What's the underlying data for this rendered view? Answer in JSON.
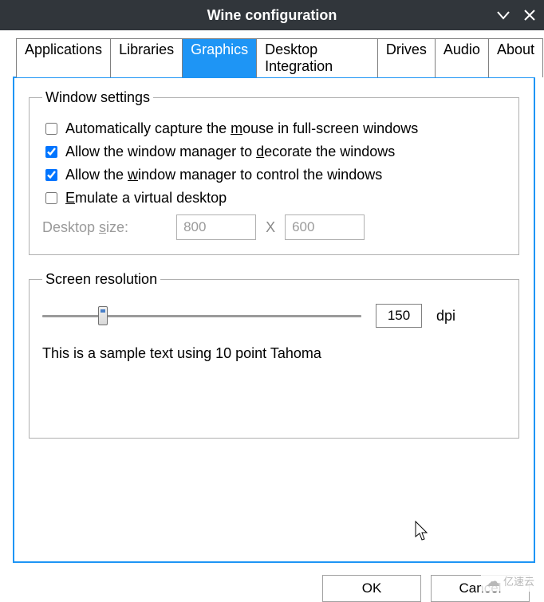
{
  "window": {
    "title": "Wine configuration"
  },
  "tabs": {
    "items": [
      {
        "label": "Applications"
      },
      {
        "label": "Libraries"
      },
      {
        "label": "Graphics"
      },
      {
        "label": "Desktop Integration"
      },
      {
        "label": "Drives"
      },
      {
        "label": "Audio"
      },
      {
        "label": "About"
      }
    ],
    "active": "Graphics"
  },
  "window_settings": {
    "legend": "Window settings",
    "auto_capture": {
      "pre": "Automatically capture the ",
      "mn": "m",
      "post": "ouse in full-screen windows",
      "checked": false
    },
    "wm_decorate": {
      "pre": "Allow the window manager to ",
      "mn": "d",
      "post": "ecorate the windows",
      "checked": true
    },
    "wm_control": {
      "pre": "Allow the ",
      "mn": "w",
      "post": "indow manager to control the windows",
      "checked": true
    },
    "virtual_desktop": {
      "mn": "E",
      "post": "mulate a virtual desktop",
      "checked": false
    },
    "desktop_size": {
      "label_pre": "Desktop ",
      "label_mn": "s",
      "label_post": "ize:",
      "width": "800",
      "height": "600",
      "sep": "X"
    }
  },
  "screen_resolution": {
    "legend": "Screen resolution",
    "dpi_value": "150",
    "dpi_unit": "dpi",
    "slider_percent": 19,
    "sample_text": "This is a sample text using 10 point Tahoma"
  },
  "buttons": {
    "ok": "OK",
    "cancel": "Cancel"
  },
  "watermark": "亿速云"
}
